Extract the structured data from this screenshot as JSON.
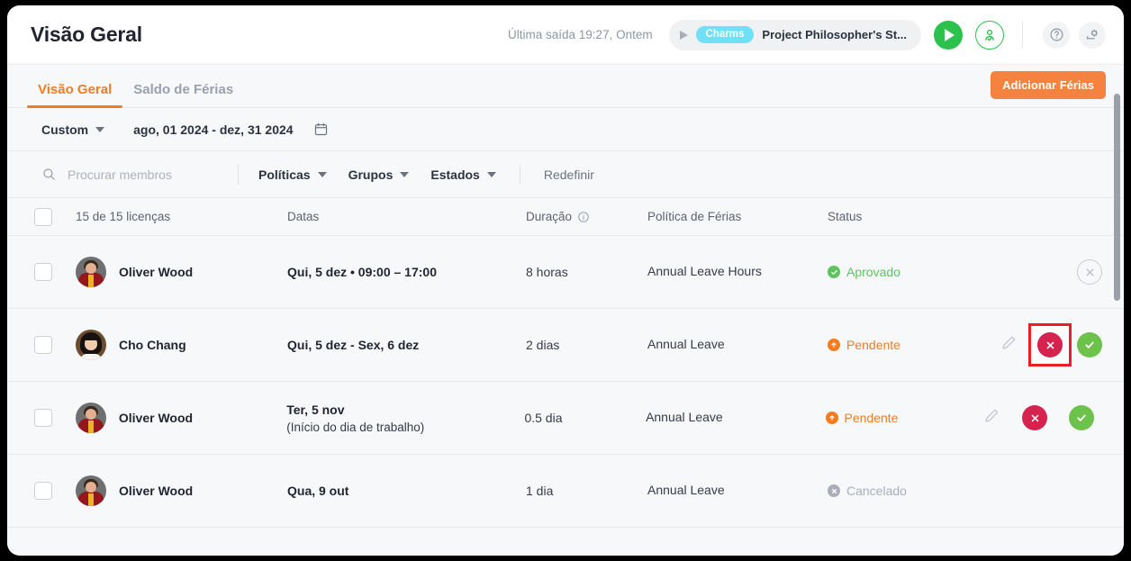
{
  "topbar": {
    "title": "Visão Geral",
    "last_out": "Última saída 19:27, Ontem",
    "timer": {
      "tag": "Charms",
      "project": "Project Philosopher's St..."
    },
    "icons": {
      "play": "play-icon",
      "person": "person-check-icon",
      "help": "question-mark-icon",
      "settings": "settings-gear-icon"
    }
  },
  "tabs": [
    {
      "label": "Visão Geral",
      "active": true
    },
    {
      "label": "Saldo de Férias",
      "active": false
    }
  ],
  "add_button": {
    "label": "Adicionar Férias",
    "color": "#f5833f"
  },
  "daterow": {
    "preset": "Custom",
    "range": "ago, 01 2024 - dez, 31 2024",
    "calendar_icon": "calendar-icon"
  },
  "filters": {
    "search_placeholder": "Procurar membros",
    "search_icon": "search-icon",
    "dropdowns": [
      "Políticas",
      "Grupos",
      "Estados"
    ],
    "reset": "Redefinir"
  },
  "table": {
    "headers": {
      "licenses": "15 de 15 licenças",
      "dates": "Datas",
      "duration": "Duração",
      "duration_info_icon": "info-icon",
      "policy": "Política de Férias",
      "status": "Status"
    },
    "rows": [
      {
        "name": "Oliver Wood",
        "avatar": "av-ow",
        "dates": "Qui, 5 dez • 09:00 – 17:00",
        "dates_sub": "",
        "duration": "8 horas",
        "policy": "Annual Leave Hours",
        "status": "Aprovado",
        "status_kind": "approved",
        "actions": [
          "cancel-outline"
        ],
        "selected_action": ""
      },
      {
        "name": "Cho Chang",
        "avatar": "av-cc",
        "dates": "Qui, 5 dez - Sex, 6 dez",
        "dates_sub": "",
        "duration": "2 dias",
        "policy": "Annual Leave",
        "status": "Pendente",
        "status_kind": "pending",
        "actions": [
          "edit",
          "reject",
          "approve"
        ],
        "selected_action": "reject"
      },
      {
        "name": "Oliver Wood",
        "avatar": "av-ow",
        "dates": "Ter, 5 nov",
        "dates_sub": "(Início do dia de trabalho)",
        "duration": "0.5 dia",
        "policy": "Annual Leave",
        "status": "Pendente",
        "status_kind": "pending",
        "actions": [
          "edit",
          "reject",
          "approve"
        ],
        "selected_action": ""
      },
      {
        "name": "Oliver Wood",
        "avatar": "av-ow",
        "dates": "Qua, 9 out",
        "dates_sub": "",
        "duration": "1 dia",
        "policy": "Annual Leave",
        "status": "Cancelado",
        "status_kind": "cancelled",
        "actions": [],
        "selected_action": ""
      }
    ]
  },
  "colors": {
    "accent_orange": "#f47b20",
    "approved_green": "#5cc45f",
    "pending_orange": "#f47b20",
    "cancelled_grey": "#a9aeb8",
    "reject_red": "#d6224e",
    "approve_green": "#6cc24a",
    "selection_red": "#ee1d23",
    "tag_cyan": "#6fe0f5"
  }
}
